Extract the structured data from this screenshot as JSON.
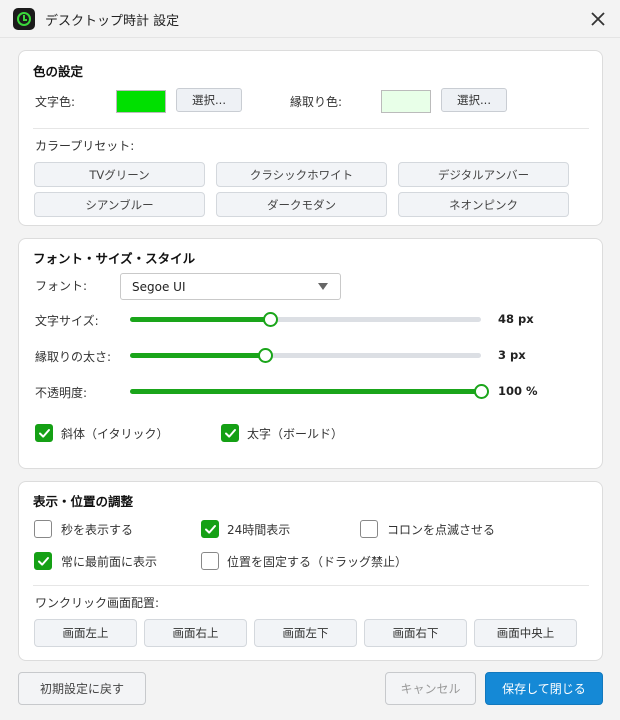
{
  "window": {
    "title": "デスクトップ時計 設定",
    "icon": "clock-icon",
    "close_icon": "close-icon"
  },
  "colors_section": {
    "title": "色の設定",
    "text_color_label": "文字色:",
    "text_color_value": "#00e000",
    "text_color_button": "選択...",
    "outline_color_label": "縁取り色:",
    "outline_color_value": "#e8ffe8",
    "outline_color_button": "選択...",
    "presets_label": "カラープリセット:",
    "presets": [
      "TVグリーン",
      "クラシックホワイト",
      "デジタルアンバー",
      "シアンブルー",
      "ダークモダン",
      "ネオンピンク"
    ]
  },
  "font_section": {
    "title": "フォント・サイズ・スタイル",
    "font_label": "フォント:",
    "font_value": "Segoe UI",
    "size_label": "文字サイズ:",
    "size_value": "48 px",
    "size_fraction": 0.4,
    "outline_width_label": "縁取りの太さ:",
    "outline_width_value": "3 px",
    "outline_width_fraction": 0.385,
    "opacity_label": "不透明度:",
    "opacity_value": "100 %",
    "opacity_fraction": 1.0,
    "italic_label": "斜体（イタリック）",
    "italic_checked": true,
    "bold_label": "太字（ボールド）",
    "bold_checked": true
  },
  "display_section": {
    "title": "表示・位置の調整",
    "show_seconds_label": "秒を表示する",
    "show_seconds_checked": false,
    "h24_label": "24時間表示",
    "h24_checked": true,
    "blink_colon_label": "コロンを点滅させる",
    "blink_colon_checked": false,
    "always_on_top_label": "常に最前面に表示",
    "always_on_top_checked": true,
    "lock_position_label": "位置を固定する（ドラッグ禁止）",
    "lock_position_checked": false,
    "placement_label": "ワンクリック画面配置:",
    "placements": [
      "画面左上",
      "画面右上",
      "画面左下",
      "画面右下",
      "画面中央上"
    ]
  },
  "footer": {
    "reset_label": "初期設定に戻す",
    "cancel_label": "キャンセル",
    "save_label": "保存して閉じる"
  },
  "theme": {
    "accent": "#1aa51a",
    "primary_button": "#1589d6"
  }
}
